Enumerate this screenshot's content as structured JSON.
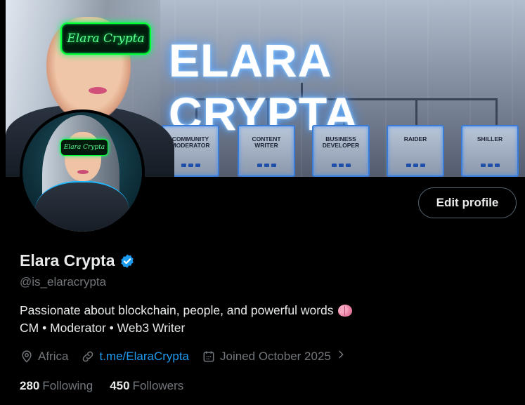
{
  "banner": {
    "title": "ELARA CRYPTA",
    "visor_text": "Elara Crypta",
    "roles": [
      "COMMUNITY MODERATOR",
      "CONTENT WRITER",
      "BUSINESS DEVELOPER",
      "RAIDER",
      "SHILLER"
    ]
  },
  "avatar": {
    "visor_text": "Elara Crypta"
  },
  "edit_button": "Edit profile",
  "profile": {
    "name": "Elara Crypta",
    "handle": "@is_elaracrypta",
    "bio_line1": "Passionate about blockchain, people, and powerful words",
    "bio_line2": "CM • Moderator • Web3 Writer",
    "location": "Africa",
    "link": "t.me/ElaraCrypta",
    "joined": "Joined October 2025"
  },
  "stats": {
    "following_count": "280",
    "following_label": "Following",
    "followers_count": "450",
    "followers_label": "Followers"
  },
  "colors": {
    "accent": "#1d9bf0",
    "muted": "#71767b",
    "text": "#e7e9ea"
  }
}
